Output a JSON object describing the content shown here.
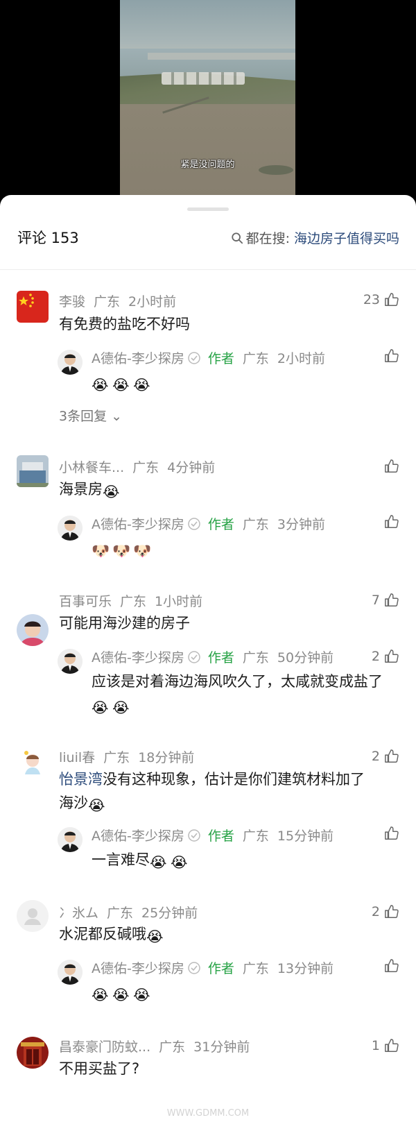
{
  "video": {
    "subtitle": "紧是没问题的"
  },
  "header": {
    "comment_label": "评论 153",
    "search_prefix": "都在搜:",
    "search_keyword": "海边房子值得买吗"
  },
  "comments": [
    {
      "user": "李骏",
      "region": "广东",
      "time": "2小时前",
      "likes": "23",
      "text": "有免费的盐吃不好吗",
      "reply": {
        "user": "A德佑-李少探房",
        "tag": "作者",
        "region": "广东",
        "time": "2小时前",
        "likes": "",
        "text": ""
      },
      "expand": "3条回复"
    },
    {
      "user": "小林餐车...",
      "region": "广东",
      "time": "4分钟前",
      "likes": "",
      "text": "海景房",
      "reply": {
        "user": "A德佑-李少探房",
        "tag": "作者",
        "region": "广东",
        "time": "3分钟前",
        "likes": "",
        "text": ""
      }
    },
    {
      "user": "百事可乐",
      "region": "广东",
      "time": "1小时前",
      "likes": "7",
      "text": "可能用海沙建的房子",
      "reply": {
        "user": "A德佑-李少探房",
        "tag": "作者",
        "region": "广东",
        "time": "50分钟前",
        "likes": "2",
        "text": "应该是对着海边海风吹久了，太咸就变成盐了"
      }
    },
    {
      "user": "liuil春",
      "region": "广东",
      "time": "18分钟前",
      "likes": "2",
      "mention": "怡景湾",
      "text": "没有这种现象，估计是你们建筑材料加了",
      "text2": "海沙",
      "reply": {
        "user": "A德佑-李少探房",
        "tag": "作者",
        "region": "广东",
        "time": "15分钟前",
        "likes": "",
        "text": "一言难尽"
      }
    },
    {
      "user": "冫氷ム",
      "region": "广东",
      "time": "25分钟前",
      "likes": "2",
      "text": "水泥都反碱哦",
      "reply": {
        "user": "A德佑-李少探房",
        "tag": "作者",
        "region": "广东",
        "time": "13分钟前",
        "likes": "",
        "text": ""
      }
    },
    {
      "user": "昌泰豪门防蚊...",
      "region": "广东",
      "time": "31分钟前",
      "likes": "1",
      "text": "不用买盐了?"
    }
  ],
  "watermark": "WWW.GDMM.COM",
  "colors": {
    "author_tag": "#25a244",
    "mention": "#2b4a7a",
    "meta": "#8a8a8a"
  }
}
